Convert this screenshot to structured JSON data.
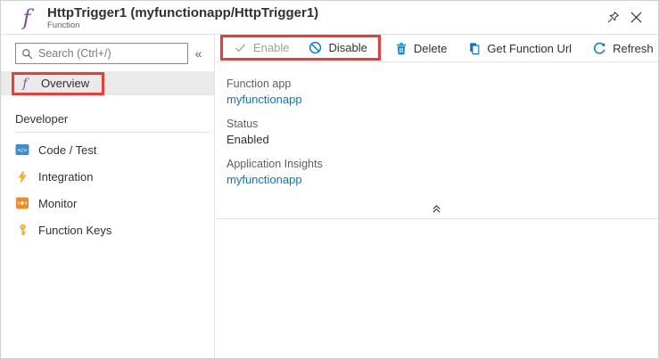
{
  "header": {
    "title": "HttpTrigger1 (myfunctionapp/HttpTrigger1)",
    "subtitle": "Function"
  },
  "icons": {
    "function_glyph": "f",
    "code_glyph": "</>"
  },
  "sidebar": {
    "search_placeholder": "Search (Ctrl+/)",
    "collapse_glyph": "«",
    "overview_label": "Overview",
    "section_title": "Developer",
    "items": [
      {
        "label": "Code / Test"
      },
      {
        "label": "Integration"
      },
      {
        "label": "Monitor"
      },
      {
        "label": "Function Keys"
      }
    ]
  },
  "toolbar": {
    "enable_label": "Enable",
    "disable_label": "Disable",
    "delete_label": "Delete",
    "get_function_url_label": "Get Function Url",
    "refresh_label": "Refresh"
  },
  "main": {
    "fields": [
      {
        "label": "Function app",
        "value": "myfunctionapp"
      },
      {
        "label": "Status",
        "value": "Enabled"
      },
      {
        "label": "Application Insights",
        "value": "myfunctionapp"
      }
    ]
  },
  "colors": {
    "accent_blue": "#0078d4",
    "highlight_red": "#ee3b35",
    "function_purple": "#7b4fa0",
    "selected_row_bg": "#eaeaea"
  }
}
